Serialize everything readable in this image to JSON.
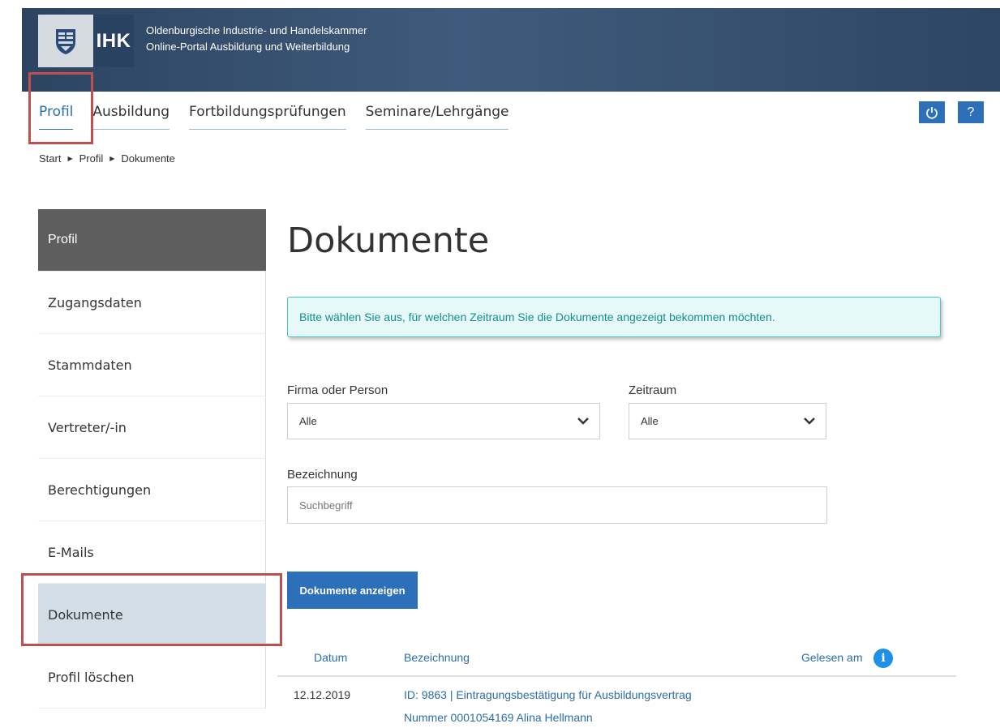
{
  "header": {
    "logo_text": "IHK",
    "org_name": "Oldenburgische Industrie- und Handelskammer",
    "portal_name": "Online-Portal Ausbildung und Weiterbildung"
  },
  "topnav": {
    "items": [
      "Profil",
      "Ausbildung",
      "Fortbildungsprüfungen",
      "Seminare/Lehrgänge"
    ],
    "active": "Profil"
  },
  "toolbar": {
    "help_label": "?"
  },
  "breadcrumb": [
    "Start",
    "Profil",
    "Dokumente"
  ],
  "sidebar": {
    "heading": "Profil",
    "items": [
      "Zugangsdaten",
      "Stammdaten",
      "Vertreter/-in",
      "Berechtigungen",
      "E-Mails",
      "Dokumente",
      "Profil löschen"
    ],
    "selected": "Dokumente"
  },
  "main": {
    "title": "Dokumente",
    "info": "Bitte wählen Sie aus, für welchen Zeitraum Sie die Dokumente angezeigt bekommen möchten.",
    "filters": {
      "firma_label": "Firma oder Person",
      "firma_value": "Alle",
      "zeitraum_label": "Zeitraum",
      "zeitraum_value": "Alle",
      "bezeichnung_label": "Bezeichnung",
      "bezeichnung_placeholder": "Suchbegriff"
    },
    "submit_label": "Dokumente anzeigen"
  },
  "table": {
    "columns": [
      "Datum",
      "Bezeichnung",
      "Gelesen am"
    ],
    "rows": [
      {
        "datum": "12.12.2019",
        "bezeichnung_line1": "ID: 9863 | Eintragungsbestätigung für Ausbildungsvertrag",
        "bezeichnung_line2": "Nummer 0001054169 Alina Hellmann",
        "gelesen_am": ""
      }
    ]
  },
  "colors": {
    "brand_blue": "#2d6fb8",
    "header_navy": "#2d4461",
    "info_teal": "#138f8c",
    "highlight_red": "#c0504d",
    "selected_bg": "#d2dde6"
  }
}
